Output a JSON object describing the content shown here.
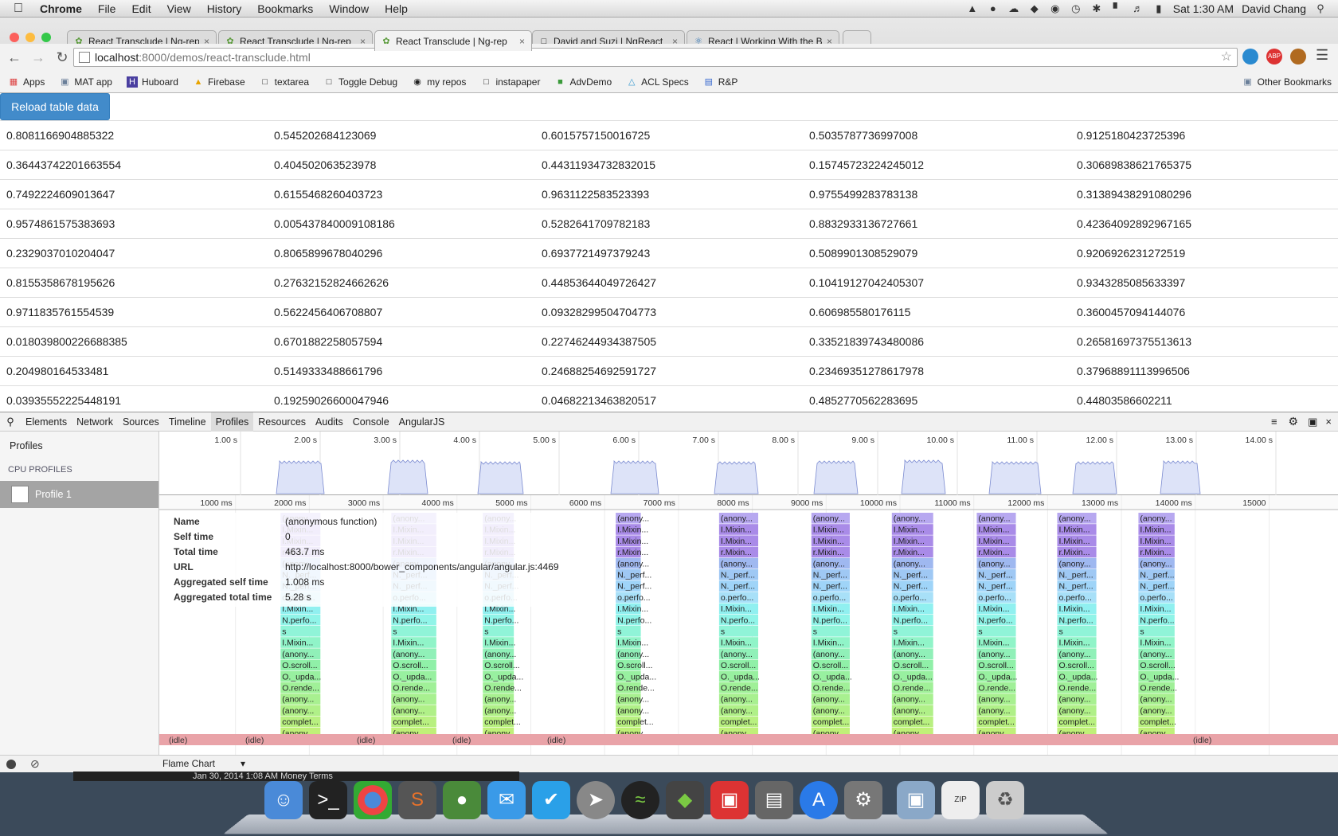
{
  "menubar": {
    "app": "Chrome",
    "items": [
      "File",
      "Edit",
      "View",
      "History",
      "Bookmarks",
      "Window",
      "Help"
    ],
    "clock": "Sat 1:30 AM",
    "user": "David Chang"
  },
  "tabs": [
    {
      "title": "React Transclude | Ng-rep"
    },
    {
      "title": "React Transclude | Ng-rep"
    },
    {
      "title": "React Transclude | Ng-rep"
    },
    {
      "title": "David and Suzi | NgReact"
    },
    {
      "title": "React | Working With the B"
    }
  ],
  "omnibox": {
    "host": "localhost",
    "path": ":8000/demos/react-transclude.html"
  },
  "bookmarks": [
    "Apps",
    "MAT app",
    "Huboard",
    "Firebase",
    "textarea",
    "Toggle Debug",
    "my repos",
    "instapaper",
    "AdvDemo",
    "ACL Specs",
    "R&P"
  ],
  "bookmarks_other": "Other Bookmarks",
  "page": {
    "reload_label": "Reload table data",
    "rows": [
      [
        "0.8081166904885322",
        "0.545202684123069",
        "0.6015757150016725",
        "0.5035787736997008",
        "0.9125180423725396"
      ],
      [
        "0.36443742201663554",
        "0.404502063523978",
        "0.44311934732832015",
        "0.15745723224245012",
        "0.30689838621765375"
      ],
      [
        "0.7492224609013647",
        "0.6155468260403723",
        "0.9631122583523393",
        "0.9755499283783138",
        "0.31389438291080296"
      ],
      [
        "0.9574861575383693",
        "0.005437840009108186",
        "0.5282641709782183",
        "0.8832933136727661",
        "0.42364092892967165"
      ],
      [
        "0.2329037010204047",
        "0.8065899678040296",
        "0.6937721497379243",
        "0.5089901308529079",
        "0.9206926231272519"
      ],
      [
        "0.8155358678195626",
        "0.27632152824662626",
        "0.44853644049726427",
        "0.10419127042405307",
        "0.9343285085633397"
      ],
      [
        "0.9711835761554539",
        "0.5622456406708807",
        "0.09328299504704773",
        "0.606985580176115",
        "0.3600457094144076"
      ],
      [
        "0.018039800226688385",
        "0.6701882258057594",
        "0.22746244934387505",
        "0.33521839743480086",
        "0.26581697375513613"
      ],
      [
        "0.204980164533481",
        "0.5149333488661796",
        "0.24688254692591727",
        "0.23469351278617978",
        "0.37968891113996506"
      ],
      [
        "0.03935552225448191",
        "0.19259026600047946",
        "0.04682213463820517",
        "0.4852770562283695",
        "0.44803586602211"
      ]
    ]
  },
  "devtools": {
    "tabs": [
      "Elements",
      "Network",
      "Sources",
      "Timeline",
      "Profiles",
      "Resources",
      "Audits",
      "Console",
      "AngularJS"
    ],
    "active_tab": "Profiles",
    "sidebar_title": "Profiles",
    "section": "CPU PROFILES",
    "profile": "Profile 1",
    "view_mode": "Flame Chart",
    "overview_ticks": [
      "1.00 s",
      "2.00 s",
      "3.00 s",
      "4.00 s",
      "5.00 s",
      "6.00 s",
      "7.00 s",
      "8.00 s",
      "9.00 s",
      "10.00 s",
      "11.00 s",
      "12.00 s",
      "13.00 s",
      "14.00 s"
    ],
    "ms_ticks": [
      "1000 ms",
      "2000 ms",
      "3000 ms",
      "4000 ms",
      "5000 ms",
      "6000 ms",
      "7000 ms",
      "8000 ms",
      "9000 ms",
      "10000 ms",
      "11000 ms",
      "12000 ms",
      "13000 ms",
      "14000 ms",
      "15000"
    ],
    "details": [
      {
        "k": "Name",
        "v": "(anonymous function)"
      },
      {
        "k": "Self time",
        "v": "0"
      },
      {
        "k": "Total time",
        "v": "463.7 ms"
      },
      {
        "k": "URL",
        "v": "http://localhost:8000/bower_components/angular/angular.js:4469"
      },
      {
        "k": "Aggregated self time",
        "v": "1.008 ms"
      },
      {
        "k": "Aggregated total time",
        "v": "5.28 s"
      }
    ],
    "stack_labels": [
      "(anony...",
      "I.Mixin...",
      "I.Mixin...",
      "r.Mixin...",
      "(anony...",
      "N._perf...",
      "N._perf...",
      "o.perfo...",
      "I.Mixin...",
      "N.perfo...",
      "s",
      "I.Mixin...",
      "(anony...",
      "O.scroll...",
      "O._upda...",
      "O.rende...",
      "(anony...",
      "(anony...",
      "complet...",
      "(anony..."
    ],
    "idle_label": "(idle)"
  },
  "dock_bg_text": "Jan 30, 2014 1:08 AM      Money Terms",
  "colors": {
    "accent": "#428bca",
    "idle": "#e9a3a8",
    "overview_fill": "#dde3f8"
  }
}
